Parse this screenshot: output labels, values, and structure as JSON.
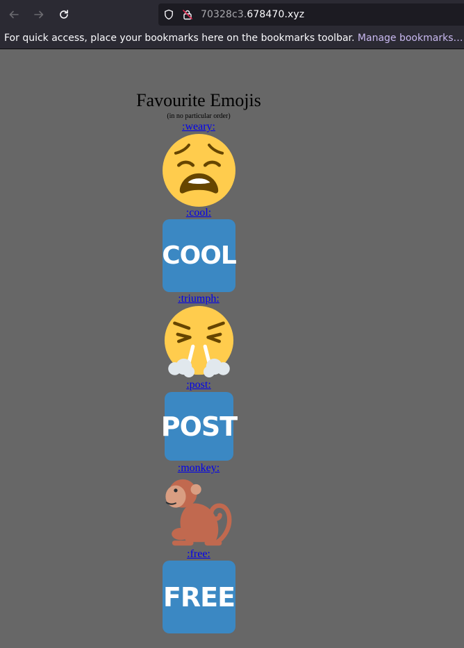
{
  "browser": {
    "url_prefix": "70328c3.",
    "url_domain": "678470.xyz",
    "bookmarks_message": "For quick access, place your bookmarks here on the bookmarks toolbar.",
    "manage_bookmarks": "Manage bookmarks…"
  },
  "page": {
    "title": "Favourite Emojis",
    "subtitle": "(in no particular order)",
    "emojis": [
      {
        "label": ":weary:",
        "icon": "weary-face-icon"
      },
      {
        "label": ":cool:",
        "icon": "cool-button-icon",
        "text": "COOL"
      },
      {
        "label": ":triumph:",
        "icon": "triumph-face-icon"
      },
      {
        "label": ":post:",
        "icon": "post-button-icon",
        "text": "POST"
      },
      {
        "label": ":monkey:",
        "icon": "monkey-icon"
      },
      {
        "label": ":free:",
        "icon": "free-button-icon",
        "text": "FREE"
      }
    ]
  },
  "colors": {
    "page_bg": "#676767",
    "link": "#0000ee",
    "emoji_blue": "#3b88c3",
    "emoji_yellow": "#ffcc4d"
  }
}
